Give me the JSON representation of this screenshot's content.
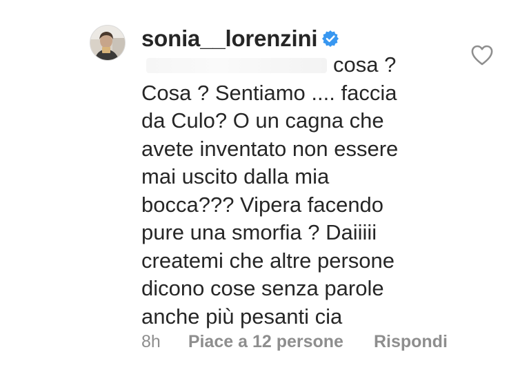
{
  "comment": {
    "username": "sonia__lorenzini",
    "verified": true,
    "avatar_icon": "profile-photo",
    "text_lines": [
      "cosa ?",
      "Cosa ? Sentiamo .... faccia",
      "da Culo? O un cagna che",
      "avete inventato non essere",
      "mai uscito dalla mia",
      "bocca??? Vipera facendo",
      "pure una smorfia ? Daiiiii",
      "createmi che altre persone",
      "dicono cose senza parole",
      "anche più pesanti cia"
    ],
    "time": "8h",
    "likes_label": "Piace a 12 persone",
    "reply_label": "Rispondi",
    "like_icon": "heart-outline-icon",
    "verified_icon": "verified-badge-icon"
  },
  "colors": {
    "text": "#262626",
    "secondary_text": "#8e8e8e",
    "verified_blue": "#3897f0"
  }
}
